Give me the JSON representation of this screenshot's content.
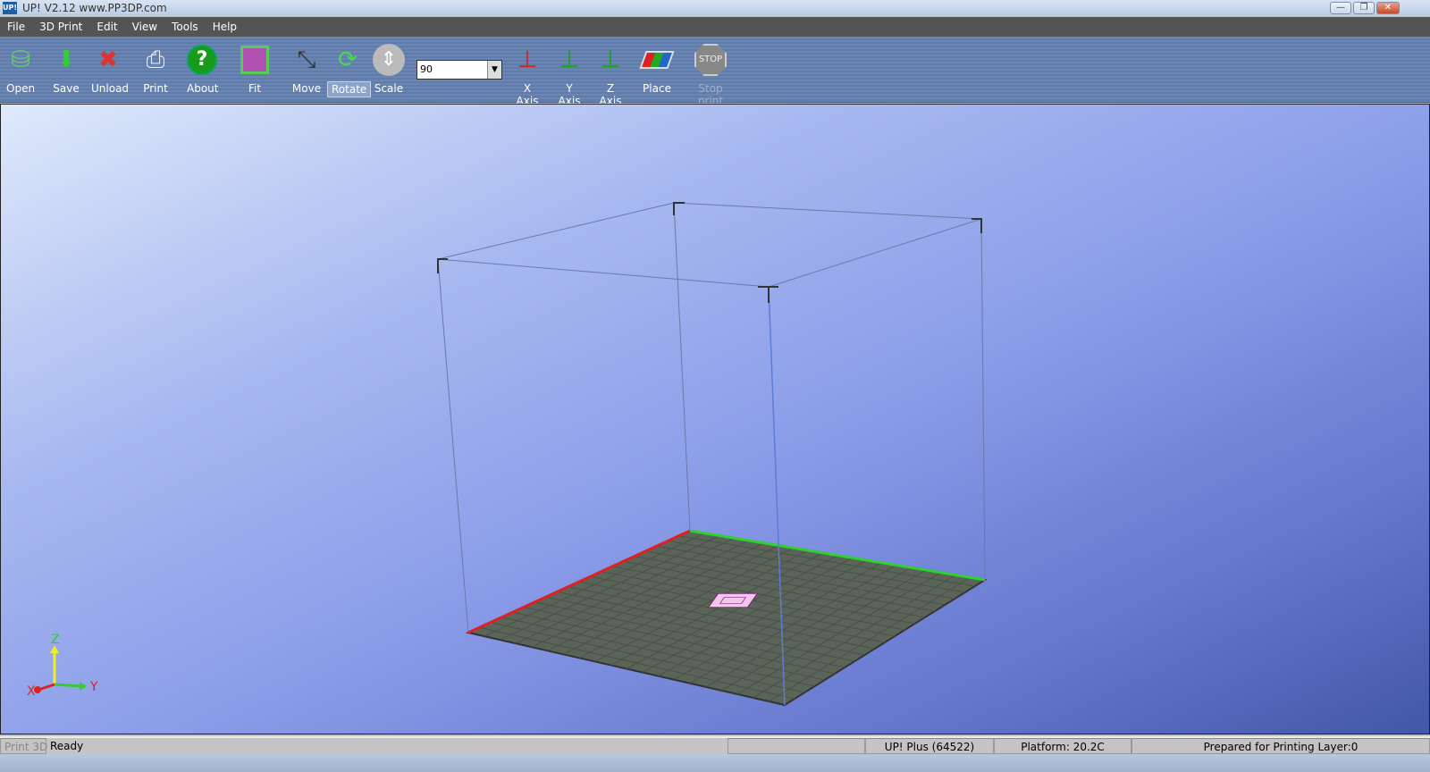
{
  "window": {
    "title": "UP!  V2.12 www.PP3DP.com",
    "icon_text": "UP!"
  },
  "menu": [
    "File",
    "3D Print",
    "Edit",
    "View",
    "Tools",
    "Help"
  ],
  "toolbar": {
    "open": "Open",
    "save": "Save",
    "unload": "Unload",
    "print": "Print",
    "about": "About",
    "fit": "Fit",
    "move": "Move",
    "rotate": "Rotate",
    "scale": "Scale",
    "angle_value": "90",
    "x_axis": "X Axis",
    "y_axis": "Y Axis",
    "z_axis": "Z Axis",
    "place": "Place",
    "stop": "Stop print",
    "stop_icon_text": "STOP",
    "active_tool": "Rotate"
  },
  "viewport": {
    "axis_labels": {
      "x": "X",
      "y": "Y",
      "z": "Z"
    },
    "colors": {
      "platform": "#5a6458",
      "x_edge": "#e02020",
      "y_edge": "#30d030",
      "model": "#f0b8e8"
    }
  },
  "status": {
    "mode": "Print 3D",
    "state": "Ready",
    "empty": "",
    "printer": "UP! Plus (64522)",
    "platform": "Platform: 20.2C",
    "layer": "Prepared for Printing Layer:0"
  }
}
